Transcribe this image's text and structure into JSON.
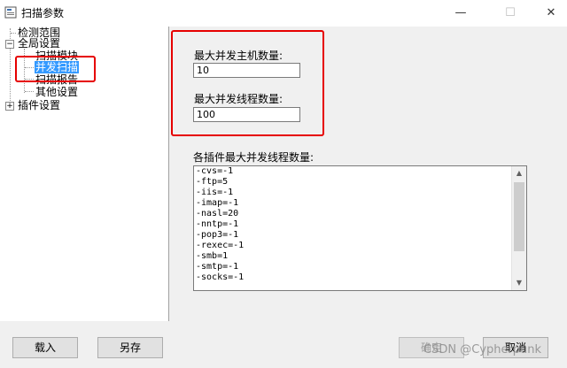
{
  "window": {
    "title": "扫描参数"
  },
  "tree": {
    "items": [
      {
        "label": "检测范围"
      },
      {
        "label": "全局设置"
      },
      {
        "label": "扫描模块"
      },
      {
        "label": "并发扫描"
      },
      {
        "label": "扫描报告"
      },
      {
        "label": "其他设置"
      },
      {
        "label": "插件设置"
      }
    ]
  },
  "main": {
    "max_hosts_label": "最大并发主机数量:",
    "max_hosts_value": "10",
    "max_threads_label": "最大并发线程数量:",
    "max_threads_value": "100",
    "plugin_threads_label": "各插件最大并发线程数量:",
    "plugin_threads": [
      "-cvs=-1",
      "-ftp=5",
      "-iis=-1",
      "-imap=-1",
      "-nasl=20",
      "-nntp=-1",
      "-pop3=-1",
      "-rexec=-1",
      "-smb=1",
      "-smtp=-1",
      "-socks=-1"
    ]
  },
  "buttons": {
    "load": "载入",
    "save_as": "另存",
    "ok": "确定",
    "cancel": "取消"
  },
  "watermark": "CSDN @Cypherpunk",
  "colors": {
    "highlight": "#e60000",
    "selection": "#3399ff"
  }
}
